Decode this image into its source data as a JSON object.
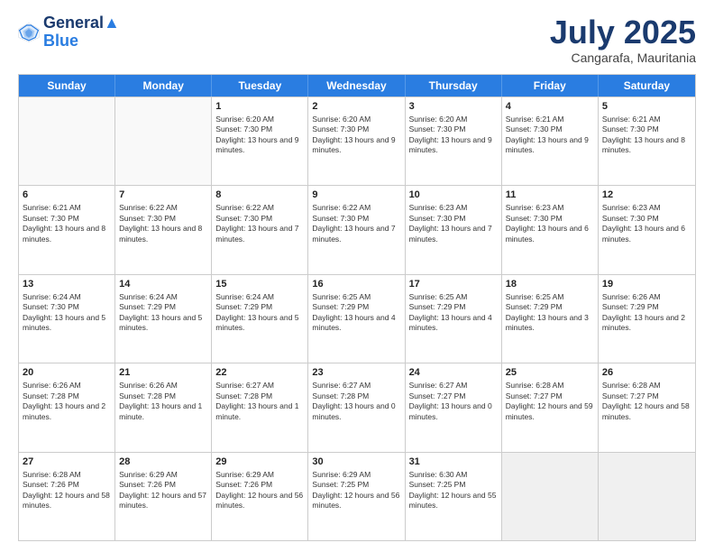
{
  "logo": {
    "line1": "General",
    "line2": "Blue"
  },
  "title": "July 2025",
  "location": "Cangarafa, Mauritania",
  "days": [
    "Sunday",
    "Monday",
    "Tuesday",
    "Wednesday",
    "Thursday",
    "Friday",
    "Saturday"
  ],
  "weeks": [
    [
      {
        "day": "",
        "empty": true
      },
      {
        "day": "",
        "empty": true
      },
      {
        "day": "1",
        "sunrise": "6:20 AM",
        "sunset": "7:30 PM",
        "daylight": "13 hours and 9 minutes."
      },
      {
        "day": "2",
        "sunrise": "6:20 AM",
        "sunset": "7:30 PM",
        "daylight": "13 hours and 9 minutes."
      },
      {
        "day": "3",
        "sunrise": "6:20 AM",
        "sunset": "7:30 PM",
        "daylight": "13 hours and 9 minutes."
      },
      {
        "day": "4",
        "sunrise": "6:21 AM",
        "sunset": "7:30 PM",
        "daylight": "13 hours and 9 minutes."
      },
      {
        "day": "5",
        "sunrise": "6:21 AM",
        "sunset": "7:30 PM",
        "daylight": "13 hours and 8 minutes."
      }
    ],
    [
      {
        "day": "6",
        "sunrise": "6:21 AM",
        "sunset": "7:30 PM",
        "daylight": "13 hours and 8 minutes."
      },
      {
        "day": "7",
        "sunrise": "6:22 AM",
        "sunset": "7:30 PM",
        "daylight": "13 hours and 8 minutes."
      },
      {
        "day": "8",
        "sunrise": "6:22 AM",
        "sunset": "7:30 PM",
        "daylight": "13 hours and 7 minutes."
      },
      {
        "day": "9",
        "sunrise": "6:22 AM",
        "sunset": "7:30 PM",
        "daylight": "13 hours and 7 minutes."
      },
      {
        "day": "10",
        "sunrise": "6:23 AM",
        "sunset": "7:30 PM",
        "daylight": "13 hours and 7 minutes."
      },
      {
        "day": "11",
        "sunrise": "6:23 AM",
        "sunset": "7:30 PM",
        "daylight": "13 hours and 6 minutes."
      },
      {
        "day": "12",
        "sunrise": "6:23 AM",
        "sunset": "7:30 PM",
        "daylight": "13 hours and 6 minutes."
      }
    ],
    [
      {
        "day": "13",
        "sunrise": "6:24 AM",
        "sunset": "7:30 PM",
        "daylight": "13 hours and 5 minutes."
      },
      {
        "day": "14",
        "sunrise": "6:24 AM",
        "sunset": "7:29 PM",
        "daylight": "13 hours and 5 minutes."
      },
      {
        "day": "15",
        "sunrise": "6:24 AM",
        "sunset": "7:29 PM",
        "daylight": "13 hours and 5 minutes."
      },
      {
        "day": "16",
        "sunrise": "6:25 AM",
        "sunset": "7:29 PM",
        "daylight": "13 hours and 4 minutes."
      },
      {
        "day": "17",
        "sunrise": "6:25 AM",
        "sunset": "7:29 PM",
        "daylight": "13 hours and 4 minutes."
      },
      {
        "day": "18",
        "sunrise": "6:25 AM",
        "sunset": "7:29 PM",
        "daylight": "13 hours and 3 minutes."
      },
      {
        "day": "19",
        "sunrise": "6:26 AM",
        "sunset": "7:29 PM",
        "daylight": "13 hours and 2 minutes."
      }
    ],
    [
      {
        "day": "20",
        "sunrise": "6:26 AM",
        "sunset": "7:28 PM",
        "daylight": "13 hours and 2 minutes."
      },
      {
        "day": "21",
        "sunrise": "6:26 AM",
        "sunset": "7:28 PM",
        "daylight": "13 hours and 1 minute."
      },
      {
        "day": "22",
        "sunrise": "6:27 AM",
        "sunset": "7:28 PM",
        "daylight": "13 hours and 1 minute."
      },
      {
        "day": "23",
        "sunrise": "6:27 AM",
        "sunset": "7:28 PM",
        "daylight": "13 hours and 0 minutes."
      },
      {
        "day": "24",
        "sunrise": "6:27 AM",
        "sunset": "7:27 PM",
        "daylight": "13 hours and 0 minutes."
      },
      {
        "day": "25",
        "sunrise": "6:28 AM",
        "sunset": "7:27 PM",
        "daylight": "12 hours and 59 minutes."
      },
      {
        "day": "26",
        "sunrise": "6:28 AM",
        "sunset": "7:27 PM",
        "daylight": "12 hours and 58 minutes."
      }
    ],
    [
      {
        "day": "27",
        "sunrise": "6:28 AM",
        "sunset": "7:26 PM",
        "daylight": "12 hours and 58 minutes."
      },
      {
        "day": "28",
        "sunrise": "6:29 AM",
        "sunset": "7:26 PM",
        "daylight": "12 hours and 57 minutes."
      },
      {
        "day": "29",
        "sunrise": "6:29 AM",
        "sunset": "7:26 PM",
        "daylight": "12 hours and 56 minutes."
      },
      {
        "day": "30",
        "sunrise": "6:29 AM",
        "sunset": "7:25 PM",
        "daylight": "12 hours and 56 minutes."
      },
      {
        "day": "31",
        "sunrise": "6:30 AM",
        "sunset": "7:25 PM",
        "daylight": "12 hours and 55 minutes."
      },
      {
        "day": "",
        "empty": true
      },
      {
        "day": "",
        "empty": true
      }
    ]
  ]
}
